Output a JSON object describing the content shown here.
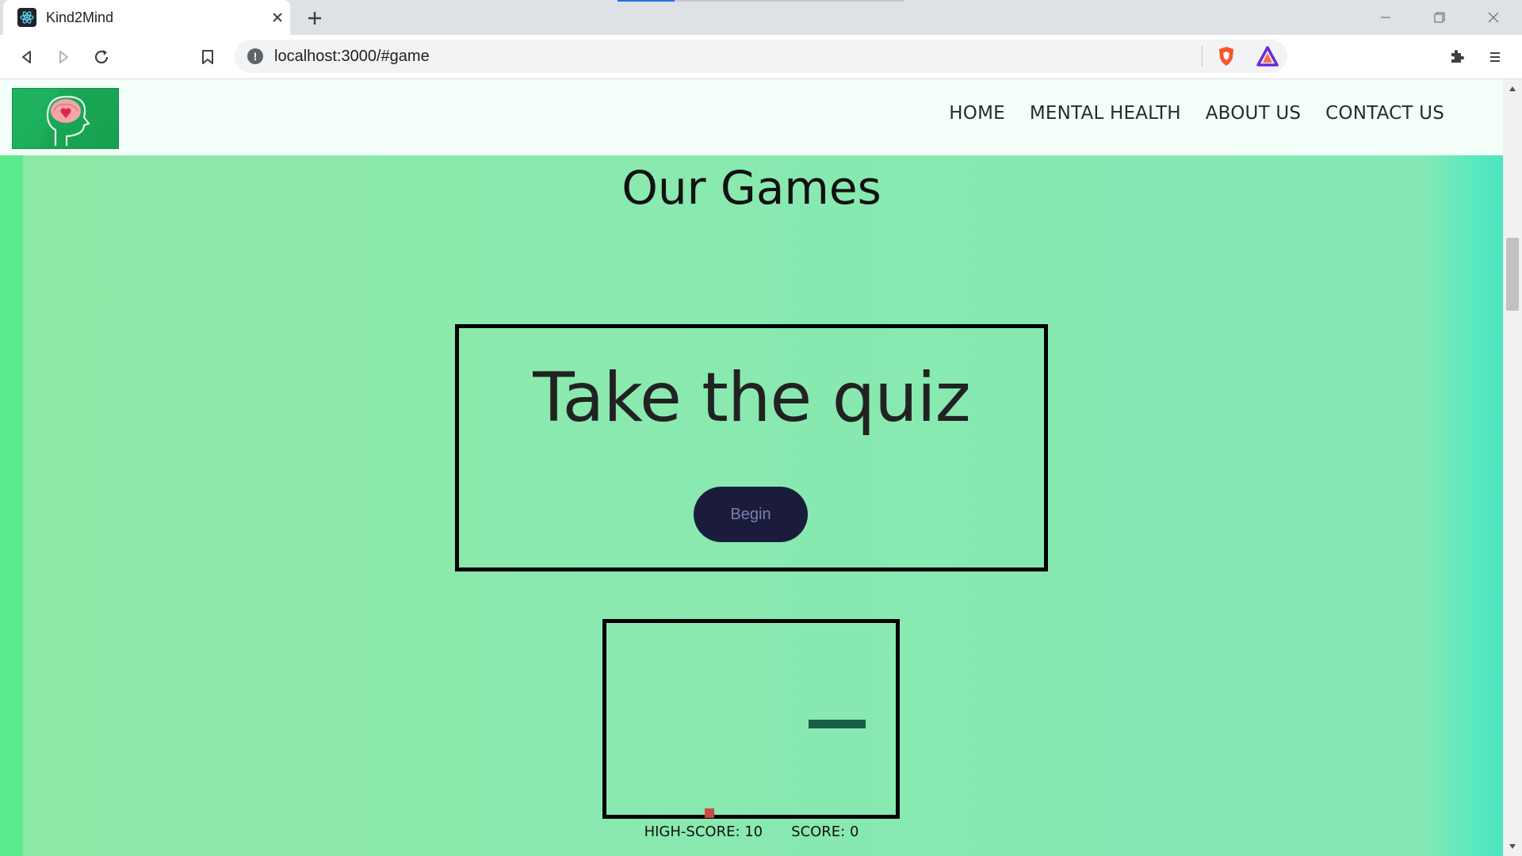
{
  "browser": {
    "tab": {
      "title": "Kind2Mind",
      "favicon": "react-logo-icon"
    },
    "address": {
      "url": "localhost:3000/#game"
    },
    "extensions": [
      "brave-shield-icon",
      "brave-rewards-icon"
    ],
    "colors": {
      "tabbar": "#dee1e6",
      "omnibox": "#f1f3f4"
    }
  },
  "site": {
    "nav": {
      "logo_alt": "Kind2Mind logo",
      "links": [
        "HOME",
        "MENTAL HEALTH",
        "ABOUT US",
        "CONTACT US"
      ]
    },
    "games": {
      "title": "Our Games",
      "quiz": {
        "heading": "Take the quiz",
        "button_label": "Begin"
      },
      "snake": {
        "high_score_label": "HIGH-SCORE: 10",
        "score_label": "SCORE: 0",
        "snake_color": "#1a5e4a",
        "food_color": "#c9474a"
      }
    },
    "colors": {
      "background_start": "#8ee9a8",
      "background_end": "#84e9b6",
      "button_bg": "#1b1c3b",
      "button_text": "#7a7fb0"
    }
  }
}
